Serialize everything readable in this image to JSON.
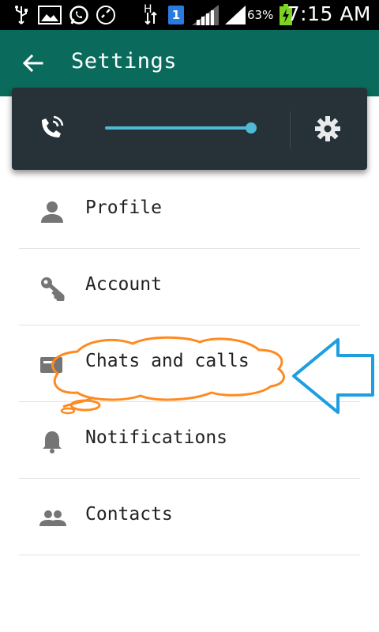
{
  "status_bar": {
    "time": "7:15 AM",
    "battery_percent": "63%",
    "sim_label": "1",
    "network_label": "H",
    "icons": [
      "usb-icon",
      "image-icon",
      "whatsapp-icon",
      "phone-call-icon",
      "data-transfer-icon",
      "sim-icon",
      "signal-icon",
      "signal-icon",
      "battery-icon"
    ]
  },
  "app_bar": {
    "title": "Settings",
    "back_icon": "arrow-back-icon",
    "background_color": "#0a6b5c"
  },
  "volume_overlay": {
    "icon": "phone-volume-icon",
    "level": 1.0,
    "settings_icon": "gear-icon",
    "accent_color": "#4fb9d6"
  },
  "settings": {
    "items": [
      {
        "label": "Profile",
        "icon": "person-icon"
      },
      {
        "label": "Account",
        "icon": "key-icon"
      },
      {
        "label": "Chats and calls",
        "icon": "chat-icon"
      },
      {
        "label": "Notifications",
        "icon": "bell-icon"
      },
      {
        "label": "Contacts",
        "icon": "group-icon"
      }
    ]
  },
  "annotations": {
    "cloud_color": "#ff8a1f",
    "arrow_color": "#1e9ee0"
  }
}
